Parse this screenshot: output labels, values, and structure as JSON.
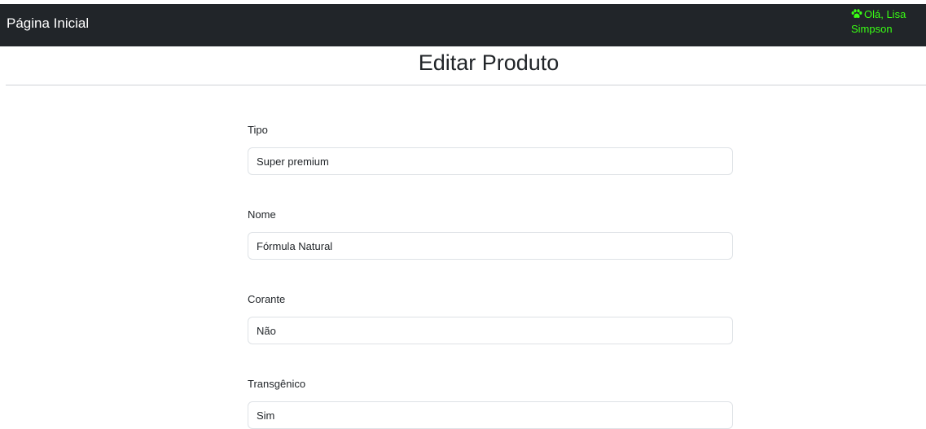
{
  "navbar": {
    "brand": "Página Inicial",
    "greeting_line1": "Olá, Lisa",
    "greeting_line2": "Simpson",
    "greeting_color": "#39ff14",
    "background": "#212529",
    "icon": "paw-icon"
  },
  "page": {
    "title": "Editar Produto"
  },
  "form": {
    "fields": [
      {
        "label": "Tipo",
        "value": "Super premium"
      },
      {
        "label": "Nome",
        "value": "Fórmula Natural"
      },
      {
        "label": "Corante",
        "value": "Não"
      },
      {
        "label": "Transgênico",
        "value": "Sim"
      }
    ]
  }
}
